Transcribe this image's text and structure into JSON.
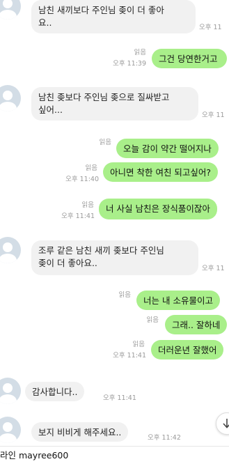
{
  "messages": [
    {
      "text": "남친 새끼보다 주인님 좆이 더 좋아\n요..",
      "time": "오후 11"
    },
    {
      "read": "읽음",
      "text": "그건 당연한거고",
      "time": "오후 11:39"
    },
    {
      "text": "남친 좆보다 주인님 좆으로 질싸받고\n싶어...",
      "time": "오후 11"
    },
    {
      "read": "읽음",
      "text": "오늘 감이 약간 떨어지나"
    },
    {
      "read": "읽음",
      "text": "아니면 착한 여친 되고싶어?",
      "time": "오후 11:40"
    },
    {
      "read": "읽음",
      "text": "너 사실 남친은 장식품이잖아",
      "time": "오후 11:41"
    },
    {
      "text": "조루 같은 남친 새끼 좆보다 주인님\n좆이 더 좋아요..",
      "time": "오후 11"
    },
    {
      "read": "읽음",
      "text": "너는 내 소유물이고"
    },
    {
      "read": "읽음",
      "text": "그래.. 잘하네"
    },
    {
      "read": "읽음",
      "text": "더러운년 잘했어",
      "time": "오후 11:41"
    },
    {
      "text": "감사합니다..",
      "time": "오후 11:41"
    },
    {
      "text": "보지 비비게 해주세요..",
      "time": "오후 11:42"
    }
  ],
  "footer": {
    "text": "라인 mayree600"
  },
  "colors": {
    "outgoing": "#a9ef8a",
    "incoming": "#f1f1f1"
  },
  "icons": {
    "avatar": "default-person-avatar",
    "scroll": "chevron-down-icon"
  }
}
